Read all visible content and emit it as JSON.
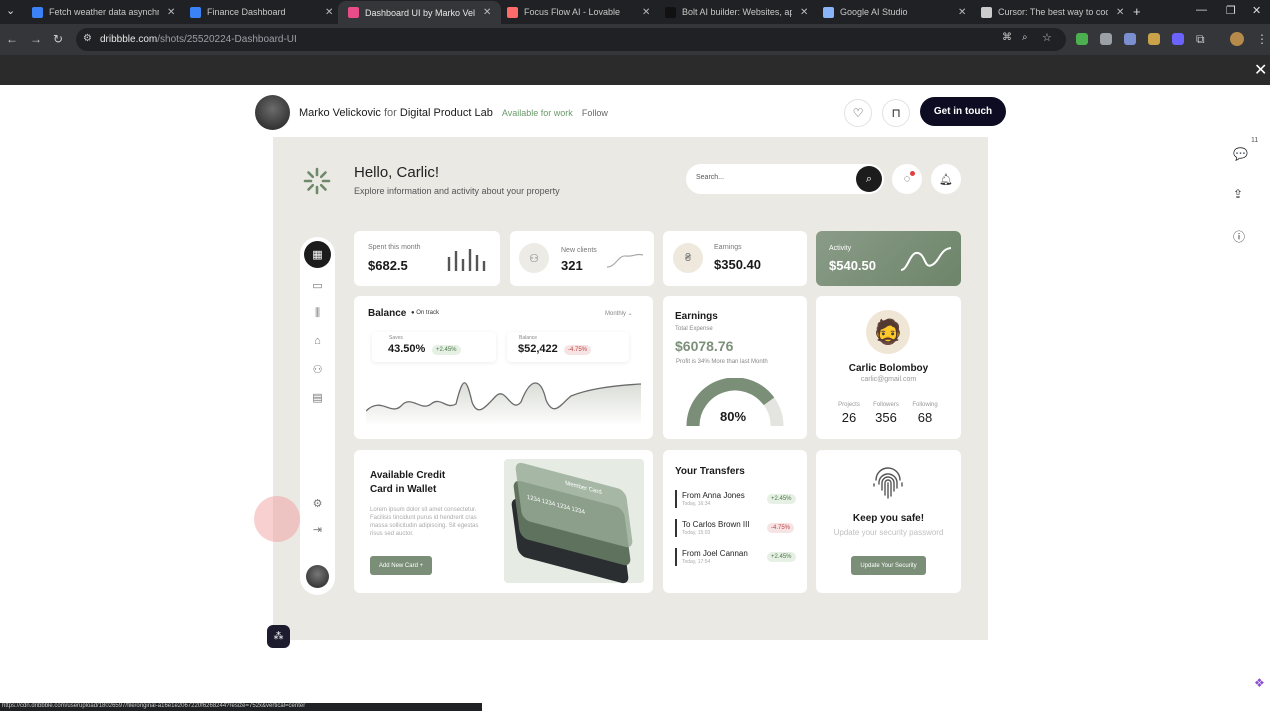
{
  "browser": {
    "tabs": [
      {
        "title": "Fetch weather data asynchron",
        "color": "#3b82f6",
        "active": false
      },
      {
        "title": "Finance Dashboard",
        "color": "#3b82f6",
        "active": false
      },
      {
        "title": "Dashboard UI by Marko Velick",
        "color": "#ea4c89",
        "active": true
      },
      {
        "title": "Focus Flow AI - Lovable",
        "color": "#ff6b6b",
        "active": false
      },
      {
        "title": "Bolt AI builder: Websites, app",
        "color": "#111111",
        "active": false
      },
      {
        "title": "Google AI Studio",
        "color": "#8ab4f8",
        "active": false
      },
      {
        "title": "Cursor: The best way to code",
        "color": "#cccccc",
        "active": false
      }
    ],
    "url_domain": "dribbble.com",
    "url_path": "/shots/25520224-Dashboard-UI",
    "status_url": "https://cdn.dribbble.com/userupload/18026597/file/original-a16e1e2067220f6268244?resize=752x&vertical=center"
  },
  "shot_header": {
    "author": "Marko Velickovic",
    "for_word": "for",
    "team": "Digital Product Lab",
    "available": "Available for work",
    "follow": "Follow",
    "cta": "Get in touch",
    "comment_count": "11"
  },
  "dashboard": {
    "greeting": "Hello, Carlic!",
    "subtitle": "Explore information and activity about your property",
    "search_placeholder": "Search...",
    "stats": [
      {
        "label": "Spent this month",
        "value": "$682.5"
      },
      {
        "label": "New clients",
        "value": "321"
      },
      {
        "label": "Earnings",
        "value": "$350.40"
      },
      {
        "label": "Activity",
        "value": "$540.50"
      }
    ],
    "balance": {
      "title": "Balance",
      "status": "On track",
      "period": "Monthly",
      "saves_label": "Saves",
      "saves_value": "43.50%",
      "saves_change": "+2.45%",
      "bal_label": "Balance",
      "bal_value": "$52,422",
      "bal_change": "-4.75%"
    },
    "earnings": {
      "title": "Earnings",
      "subtitle": "Total Expense",
      "value": "$6078.76",
      "note": "Profit is 34% More than last Month",
      "gauge": "80%",
      "gauge_fraction": 0.8
    },
    "profile": {
      "name": "Carlic Bolomboy",
      "email": "carlic@gmail.com",
      "projects_label": "Projects",
      "projects": "26",
      "followers_label": "Followers",
      "followers": "356",
      "following_label": "Following",
      "following": "68"
    },
    "credit": {
      "title_line1": "Available Credit",
      "title_line2": "Card in Wallet",
      "lorem": "Lorem ipsum dolor sit amet consectetur. Facilisis tincidunt purus id hendrerit cras massa sollicitudin adipiscing. Sit egestas risus sed auctor.",
      "button": "Add New Card +",
      "card_number": "1234 1234 1234 1234",
      "card_label": "Member Card"
    },
    "transfers": {
      "title": "Your Transfers",
      "items": [
        {
          "name": "From Anna Jones",
          "date": "Today, 16:34",
          "change": "+2.45%",
          "dir": "green"
        },
        {
          "name": "To Carlos Brown III",
          "date": "Today, 15:03",
          "change": "-4.75%",
          "dir": "red"
        },
        {
          "name": "From Joel Cannan",
          "date": "Today, 17:54",
          "change": "+2.45%",
          "dir": "green"
        }
      ]
    },
    "security": {
      "title": "Keep you safe!",
      "subtitle": "Update your security password",
      "button": "Update Your Security"
    }
  }
}
